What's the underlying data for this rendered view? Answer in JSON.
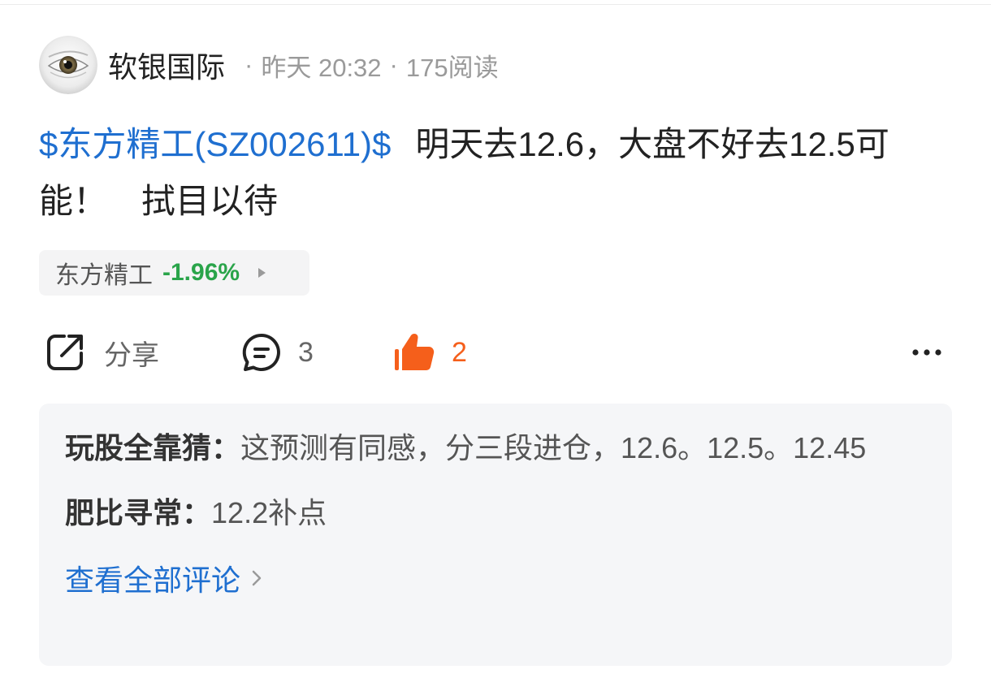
{
  "header": {
    "username": "软银国际",
    "separator": "·",
    "time": "昨天 20:32",
    "reads": "175阅读",
    "avatar_icon": "eye-avatar"
  },
  "post": {
    "stock_tag": "$东方精工(SZ002611)$",
    "text": "明天去12.6，大盘不好去12.5可能！　拭目以待"
  },
  "stock_chip": {
    "name": "东方精工",
    "change": "-1.96%",
    "change_color": "#2aa44a",
    "arrow_icon": "play-arrow-icon"
  },
  "actions": {
    "share_icon": "share-icon",
    "share_label": "分享",
    "comment_icon": "comment-icon",
    "comment_count": "3",
    "like_icon": "thumbs-up-icon",
    "like_count": "2",
    "like_color": "#f55f1b",
    "more_icon": "more-icon"
  },
  "comments_box": {
    "colon": "：",
    "comments": [
      {
        "author": "玩股全靠猜",
        "text": "这预测有同感，分三段进仓，12.6。12.5。12.45"
      },
      {
        "author": "肥比寻常",
        "text": "12.2补点"
      }
    ],
    "view_all_label": "查看全部评论",
    "chevron_icon": "chevron-right-icon"
  },
  "colors": {
    "link": "#1f6fd0",
    "text": "#222222",
    "muted": "#999999",
    "comment_bg": "#f5f6f8"
  }
}
